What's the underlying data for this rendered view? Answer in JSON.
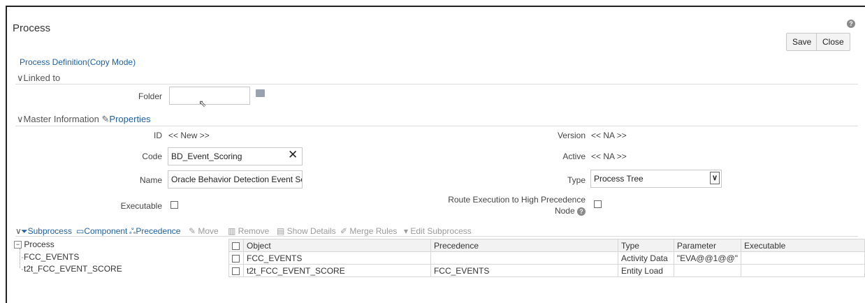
{
  "page": {
    "title": "Process",
    "save_label": "Save",
    "close_label": "Close",
    "help_glyph": "?"
  },
  "breadcrumb": "Process Definition(Copy Mode)",
  "linked": {
    "title": "Linked to",
    "folder_label": "Folder",
    "folder_value": ""
  },
  "master": {
    "title": "Master Information",
    "properties_label": "Properties",
    "id_label": "ID",
    "id_value": "<< New >>",
    "version_label": "Version",
    "version_value": "<< NA >>",
    "code_label": "Code",
    "code_value": "BD_Event_Scoring",
    "active_label": "Active",
    "active_value": "<< NA >>",
    "name_label": "Name",
    "name_value": "Oracle Behavior Detection Event Scorir",
    "type_label": "Type",
    "type_value": "Process Tree",
    "executable_label": "Executable",
    "route_label_line1": "Route Execution to High Precedence",
    "route_label_line2": "Node"
  },
  "toolbar": {
    "subprocess": "Subprocess",
    "component": "Component",
    "precedence": "Precedence",
    "move": "Move",
    "remove": "Remove",
    "show_details": "Show Details",
    "merge_rules": "Merge Rules",
    "edit_subprocess": "Edit Subprocess"
  },
  "tree": {
    "root": "Process",
    "items": [
      "FCC_EVENTS",
      "t2t_FCC_EVENT_SCORE"
    ]
  },
  "table": {
    "headers": [
      "Object",
      "Precedence",
      "Type",
      "Parameter",
      "Executable"
    ],
    "rows": [
      [
        "FCC_EVENTS",
        "",
        "Activity Data",
        "\"EVA@@1@@\"",
        ""
      ],
      [
        "t2t_FCC_EVENT_SCORE",
        "FCC_EVENTS",
        "Entity Load",
        "",
        ""
      ]
    ]
  },
  "colors": {
    "link": "#1f5f9c",
    "border": "#c8c8c8"
  }
}
